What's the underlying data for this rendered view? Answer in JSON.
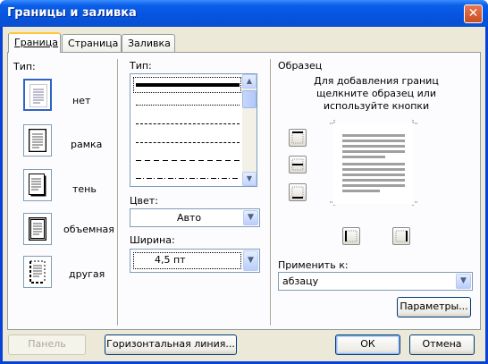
{
  "window": {
    "title": "Границы и заливка",
    "close_symbol": "✕"
  },
  "tabs": [
    {
      "label": "Граница",
      "active": true
    },
    {
      "label": "Страница",
      "active": false
    },
    {
      "label": "Заливка",
      "active": false
    }
  ],
  "type_section": {
    "label": "Тип:",
    "presets": [
      "нет",
      "рамка",
      "тень",
      "объемная",
      "другая"
    ]
  },
  "style_section": {
    "label": "Тип:",
    "line_styles": [
      "solid-thick",
      "dotted",
      "dashed-fine",
      "dashed",
      "dashed-long",
      "dash-dot"
    ],
    "color_label": "Цвет:",
    "color_value": "Авто",
    "width_label": "Ширина:",
    "width_value": "4,5 пт"
  },
  "preview_section": {
    "label": "Образец",
    "hint": "Для добавления границ щелкните образец или используйте кнопки",
    "apply_label": "Применить к:",
    "apply_value": "абзацу",
    "params_button": "Параметры..."
  },
  "footer": {
    "panel_button": "Панель",
    "hline_button": "Горизонтальная линия...",
    "ok_button": "ОК",
    "cancel_button": "Отмена"
  },
  "colors": {
    "titlebar": "#0a5ee8",
    "dialog_bg": "#ece9d8",
    "tab_highlight": "#ffc83c"
  }
}
